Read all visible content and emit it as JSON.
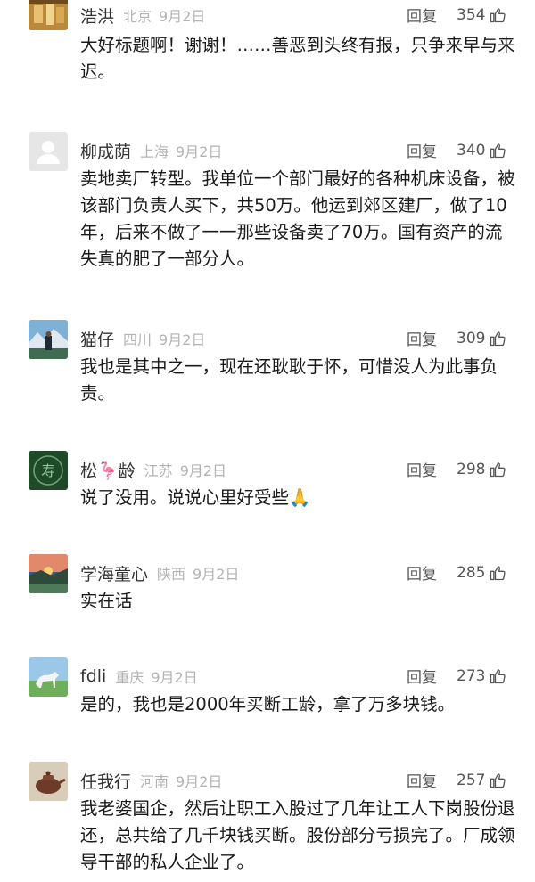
{
  "colors": {
    "meta_text": "#b3b3b3",
    "action_text": "#555555",
    "body_text": "#1a1a1a"
  },
  "comments": [
    {
      "username": "浩洪",
      "location": "北京",
      "date": "9月2日",
      "reply": "回复",
      "likes": "354",
      "text": "大好标题啊！谢谢！……善恶到头终有报，只争来早与来迟。",
      "avatar": "avatar-photo-gold"
    },
    {
      "username": "柳成荫",
      "location": "上海",
      "date": "9月2日",
      "reply": "回复",
      "likes": "340",
      "text": "卖地卖厂转型。我单位一个部门最好的各种机床设备，被该部门负责人买下，共50万。他运到郊区建厂，做了10年，后来不做了一一那些设备卖了70万。国有资产的流失真的肥了一部分人。",
      "avatar": "avatar-default-gray"
    },
    {
      "username": "猫仔",
      "location": "四川",
      "date": "9月2日",
      "reply": "回复",
      "likes": "309",
      "text": "我也是其中之一，现在还耿耿于怀，可惜没人为此事负责。",
      "avatar": "avatar-photo-mountain"
    },
    {
      "username": "松🦩龄",
      "location": "江苏",
      "date": "9月2日",
      "reply": "回复",
      "likes": "298",
      "text": "说了没用。说说心里好受些🙏",
      "avatar": "avatar-green-seal"
    },
    {
      "username": "学海童心",
      "location": "陕西",
      "date": "9月2日",
      "reply": "回复",
      "likes": "285",
      "text": "实在话",
      "avatar": "avatar-photo-sunset"
    },
    {
      "username": "fdli",
      "location": "重庆",
      "date": "9月2日",
      "reply": "回复",
      "likes": "273",
      "text": "是的，我也是2000年买断工龄，拿了万多块钱。",
      "avatar": "avatar-photo-horse"
    },
    {
      "username": "任我行",
      "location": "河南",
      "date": "9月2日",
      "reply": "回复",
      "likes": "257",
      "text": "我老婆国企，然后让职工入股过了几年让工人下岗股份退还，总共给了几千块钱买断。股份部分亏损完了。厂成领导干部的私人企业了。",
      "avatar": "avatar-photo-teapot"
    }
  ]
}
